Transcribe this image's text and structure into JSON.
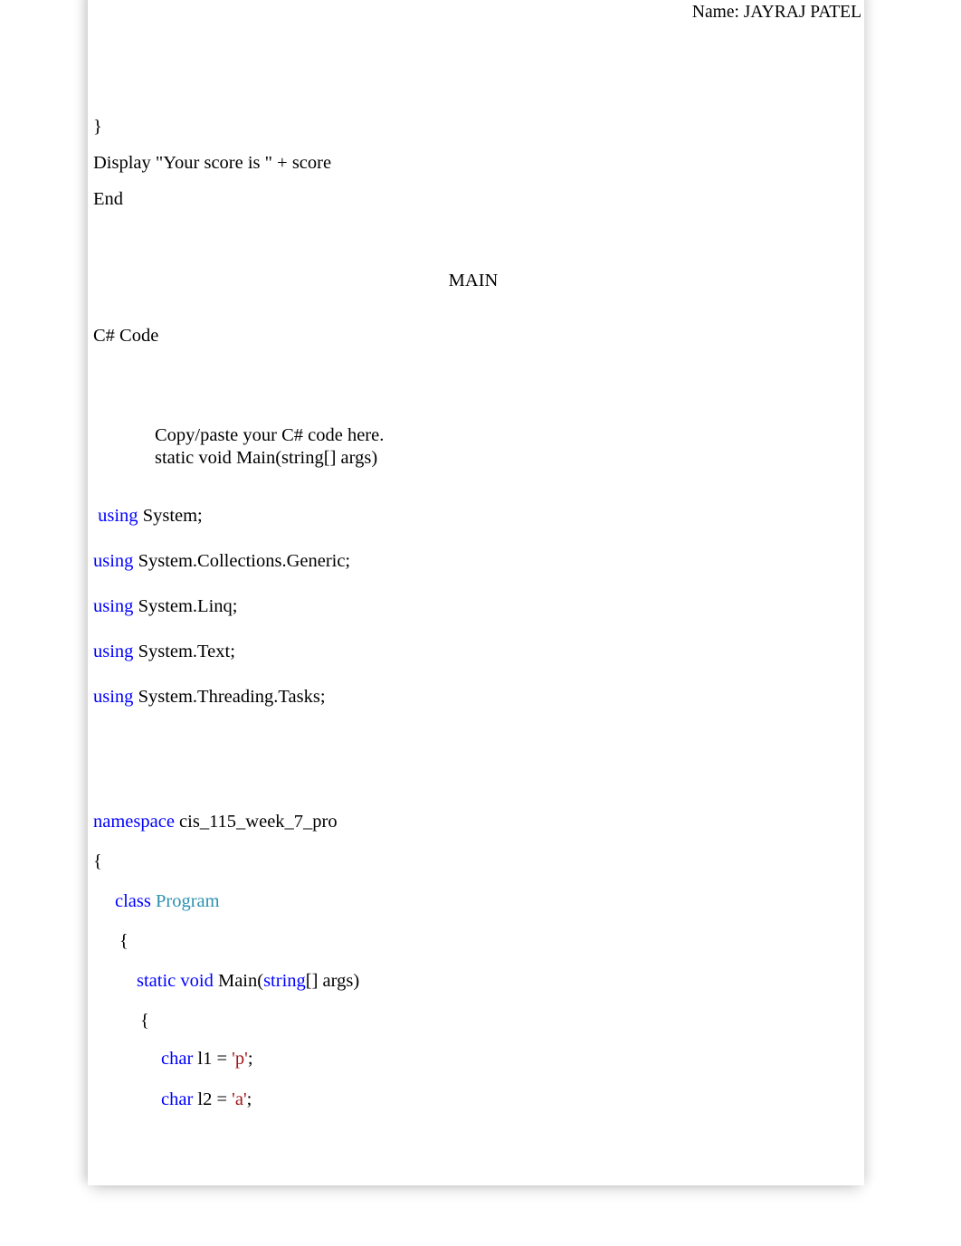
{
  "document": {
    "header": {
      "name_label": "Name: JAYRAJ PATEL"
    },
    "pseudocode_tail": {
      "close_brace": "}",
      "display_line": "Display \"Your score is \" + score",
      "end_line": "End"
    },
    "section": {
      "heading": "MAIN",
      "subheading": "C# Code"
    },
    "instructions": {
      "line1": "Copy/paste your C# code here.",
      "line2": "static void Main(string[] args)"
    },
    "code": {
      "usings": [
        {
          "keyword": "using",
          "namespace": " System;",
          "leading_space": " "
        },
        {
          "keyword": "using",
          "namespace": " System.Collections.Generic;",
          "leading_space": ""
        },
        {
          "keyword": "using",
          "namespace": " System.Linq;",
          "leading_space": ""
        },
        {
          "keyword": "using",
          "namespace": " System.Text;",
          "leading_space": ""
        },
        {
          "keyword": "using",
          "namespace": " System.Threading.Tasks;",
          "leading_space": ""
        }
      ],
      "namespace_keyword": "namespace",
      "namespace_name": " cis_115_week_7_pro",
      "namespace_open_brace": "{",
      "class_keyword": "class",
      "class_name": " Program",
      "class_open_brace": "{",
      "main_modifiers": "static void",
      "main_signature_a": " Main(",
      "main_type": "string",
      "main_signature_b": "[] args)",
      "main_open_brace": "{",
      "decl1": {
        "type": "char",
        "name": " l1 = ",
        "value": "'p'",
        "terminator": ";"
      },
      "decl2": {
        "type": "char",
        "name": " l2 = ",
        "value": "'a'",
        "terminator": ";"
      }
    },
    "colors": {
      "keyword": "#0000FF",
      "type": "#2B91AF",
      "literal": "#A31515",
      "text": "#000000",
      "page": "#FFFFFF"
    }
  }
}
